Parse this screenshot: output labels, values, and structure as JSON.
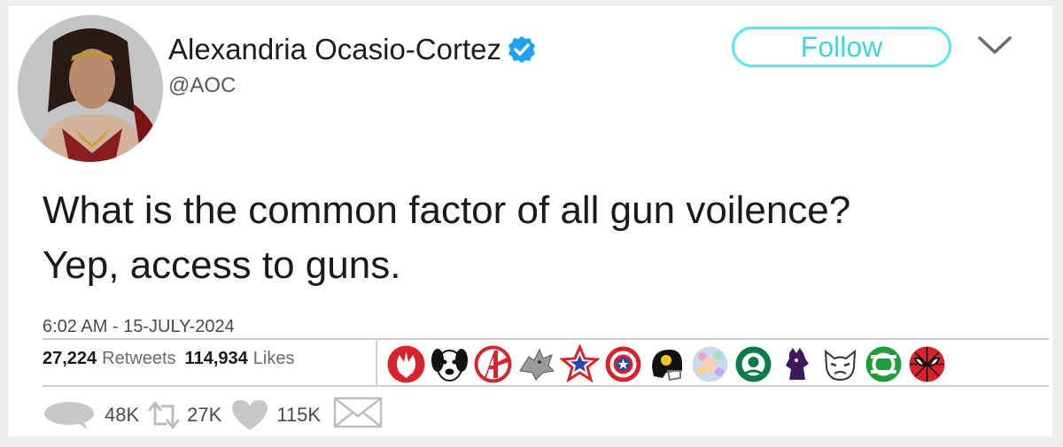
{
  "account": {
    "name": "Alexandria Ocasio-Cortez",
    "handle": "@AOC",
    "verified_icon": "verified-badge-icon"
  },
  "follow_label": "Follow",
  "menu_icon": "chevron-down-icon",
  "tweet": {
    "lines": [
      "What is the common factor of all gun voilence?",
      "Yep, access to guns."
    ],
    "timestamp": "6:02 AM - 15-JULY-2024"
  },
  "stats": {
    "retweets_count": "27,224",
    "retweets_label": "Retweets",
    "likes_count": "114,934",
    "likes_label": "Likes"
  },
  "liker_icons": [
    "rebel-alliance-icon",
    "dog-face-icon",
    "avengers-icon",
    "stark-direwolf-icon",
    "star-badge-icon",
    "captain-america-shield-icon",
    "football-helmet-icon",
    "colorful-face-icon",
    "starbucks-icon",
    "lion-crest-icon",
    "grumpy-cat-icon",
    "green-lantern-icon",
    "spider-man-icon"
  ],
  "actions": {
    "reply_count": "48K",
    "retweet_count": "27K",
    "like_count": "115K",
    "reply_icon": "reply-bubble-icon",
    "retweet_icon": "retweet-icon",
    "like_icon": "heart-icon",
    "dm_icon": "envelope-icon"
  },
  "colors": {
    "follow_accent": "#3fd3e6",
    "verified_blue": "#1da1f2",
    "action_gray": "#c8c8c8"
  }
}
